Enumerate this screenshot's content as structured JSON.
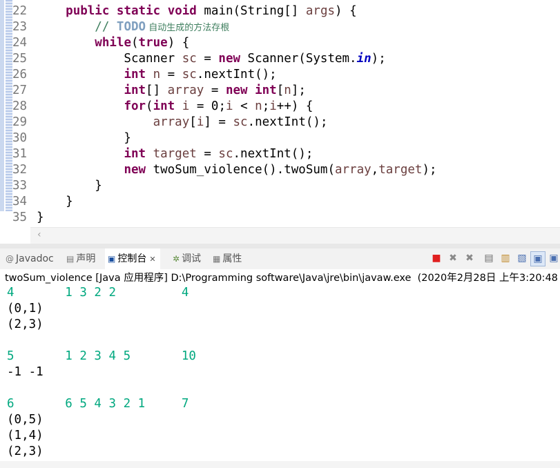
{
  "editor": {
    "lines": [
      {
        "n": "22",
        "html": "    <span class='kw'>public</span> <span class='kw'>static</span> <span class='kw'>void</span> main(String[] <span class='var'>args</span>) {"
      },
      {
        "n": "23",
        "html": "        <span class='cm'>// </span><span class='todo'>TODO</span><span class='cm cn'> 自动生成的方法存根</span>"
      },
      {
        "n": "24",
        "html": "        <span class='kw'>while</span>(<span class='kw'>true</span>) {"
      },
      {
        "n": "25",
        "html": "            Scanner <span class='var'>sc</span> = <span class='kw'>new</span> Scanner(System.<span class='fld'>in</span>);"
      },
      {
        "n": "26",
        "html": "            <span class='kw'>int</span> <span class='var'>n</span> = <span class='var'>sc</span>.nextInt();"
      },
      {
        "n": "27",
        "html": "            <span class='kw'>int</span>[] <span class='var'>array</span> = <span class='kw'>new</span> <span class='kw'>int</span>[<span class='var'>n</span>];"
      },
      {
        "n": "28",
        "html": "            <span class='kw'>for</span>(<span class='kw'>int</span> <span class='var'>i</span> = 0;<span class='var'>i</span> &lt; <span class='var'>n</span>;<span class='var'>i</span>++) {"
      },
      {
        "n": "29",
        "html": "                <span class='var'>array</span>[<span class='var'>i</span>] = <span class='var'>sc</span>.nextInt();"
      },
      {
        "n": "30",
        "html": "            }"
      },
      {
        "n": "31",
        "html": "            <span class='kw'>int</span> <span class='var'>target</span> = <span class='var'>sc</span>.nextInt();"
      },
      {
        "n": "32",
        "html": "            <span class='kw'>new</span> twoSum_violence().twoSum(<span class='var'>array</span>,<span class='var'>target</span>);"
      },
      {
        "n": "33",
        "html": "        }"
      },
      {
        "n": "34",
        "html": "    }"
      },
      {
        "n": "35",
        "html": "}"
      }
    ]
  },
  "tabs": {
    "javadoc": "Javadoc",
    "declaration": "声明",
    "console": "控制台",
    "debug": "调试",
    "properties": "属性"
  },
  "console": {
    "status": "twoSum_violence [Java 应用程序] D:\\Programming software\\Java\\jre\\bin\\javaw.exe  (2020年2月28日 上午3:20:48",
    "lines": [
      {
        "type": "in",
        "text": "4       1 3 2 2         4"
      },
      {
        "type": "std",
        "text": "(0,1)"
      },
      {
        "type": "std",
        "text": "(2,3)"
      },
      {
        "type": "std",
        "text": ""
      },
      {
        "type": "in",
        "text": "5       1 2 3 4 5       10"
      },
      {
        "type": "std",
        "text": "-1 -1"
      },
      {
        "type": "std",
        "text": ""
      },
      {
        "type": "in",
        "text": "6       6 5 4 3 2 1     7"
      },
      {
        "type": "std",
        "text": "(0,5)"
      },
      {
        "type": "std",
        "text": "(1,4)"
      },
      {
        "type": "std",
        "text": "(2,3)"
      }
    ]
  },
  "colors": {
    "keyword": "#7f0055",
    "comment": "#3f7f5f",
    "console_input": "#00a87f",
    "terminate_red": "#e02020"
  }
}
